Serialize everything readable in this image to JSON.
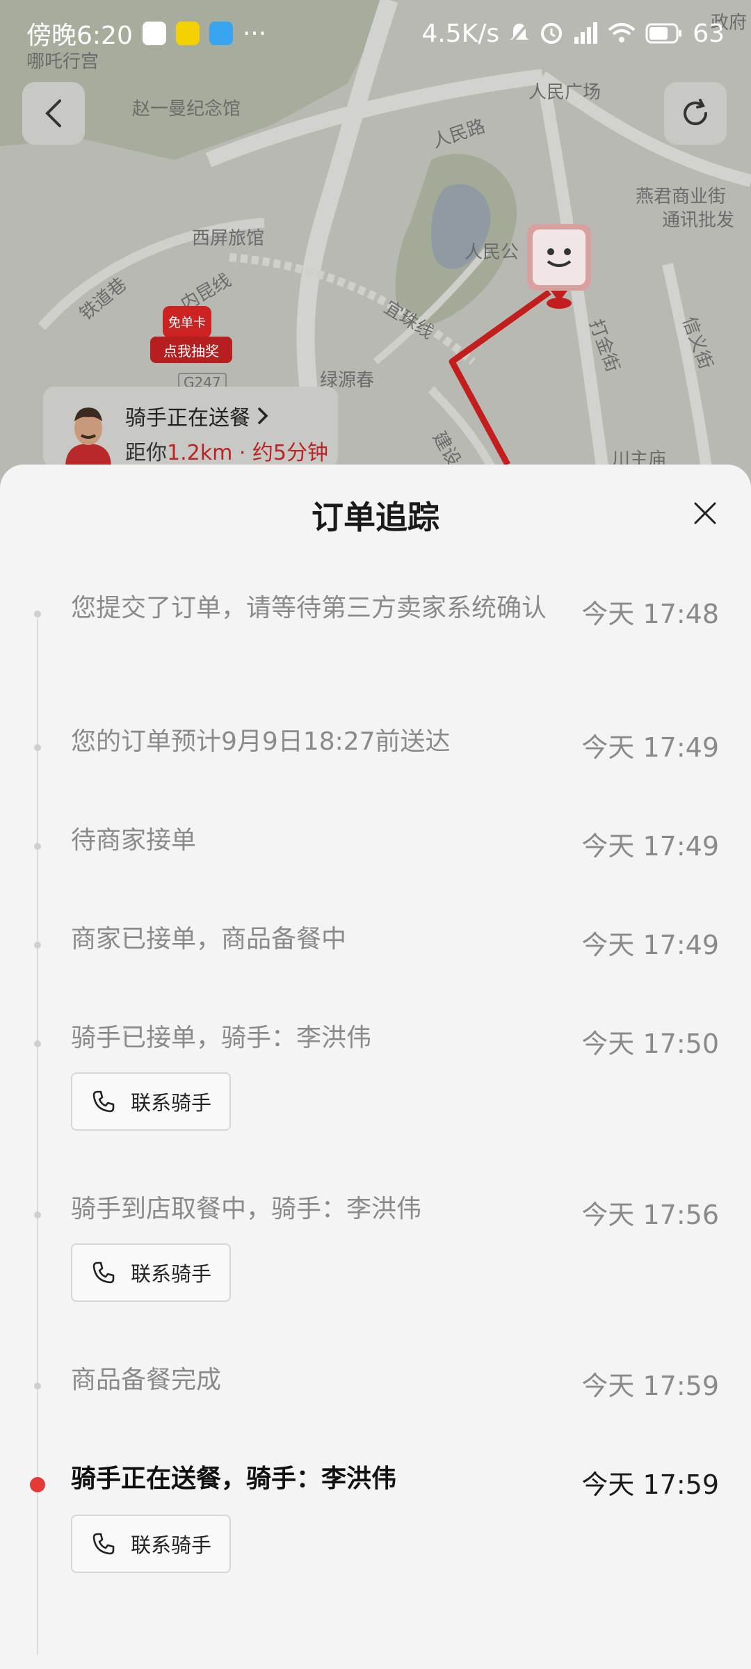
{
  "status_bar": {
    "time": "傍晚6:20",
    "more": "···",
    "speed": "4.5K/s",
    "battery": "63"
  },
  "map": {
    "labels": {
      "nezha": "哪吒行宫",
      "zhaoyiman": "赵一曼纪念馆",
      "renmin_road": "人民路",
      "renmin_square": "人民广场",
      "yanjun": "燕君商业街",
      "tongxun": "通讯批发",
      "xiping": "西屏旅馆",
      "renmin_park": "人民公",
      "railway": "铁道巷",
      "neikun": "内昆线",
      "yizhu": "宜珠线",
      "dajin": "打金街",
      "xinyi": "信义街",
      "lvyuan": "绿源春",
      "g247": "G247",
      "jian": "建设",
      "chuan": "川主庙",
      "gov": "政府"
    },
    "promo": {
      "free_card": "免单卡",
      "lottery": "点我抽奖"
    },
    "rider_card": {
      "title": "骑手正在送餐",
      "distance_prefix": "距你",
      "distance_value": "1.2km · 约5分钟"
    },
    "accent_route": "#c21e1e"
  },
  "sheet": {
    "title": "订单追踪"
  },
  "timeline": [
    {
      "text": "您提交了订单，请等待第三方卖家系统确认",
      "time": "今天 17:48"
    },
    {
      "text": "您的订单预计9月9日18:27前送达",
      "time": "今天 17:49"
    },
    {
      "text": "待商家接单",
      "time": "今天 17:49"
    },
    {
      "text": "商家已接单，商品备餐中",
      "time": "今天 17:49"
    },
    {
      "text": "骑手已接单，骑手：李洪伟",
      "time": "今天 17:50",
      "button": "联系骑手"
    },
    {
      "text": "骑手到店取餐中，骑手：李洪伟",
      "time": "今天 17:56",
      "button": "联系骑手"
    },
    {
      "text": "商品备餐完成",
      "time": "今天 17:59"
    },
    {
      "text": "骑手正在送餐，骑手：李洪伟",
      "time": "今天 17:59",
      "button": "联系骑手"
    }
  ],
  "colors": {
    "active_dot": "#e53935",
    "muted_text": "#8a8a8a"
  }
}
